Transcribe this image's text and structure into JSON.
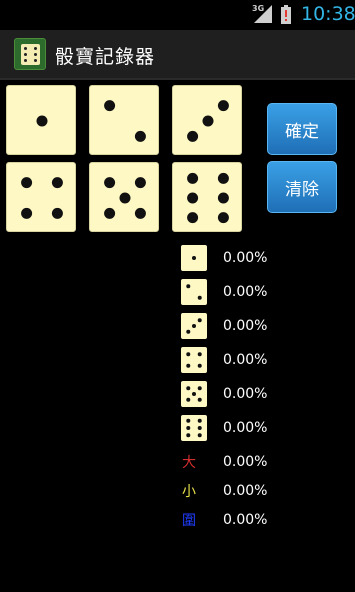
{
  "status_bar": {
    "network": "3G",
    "time": "10:38",
    "colors": {
      "time": "#33b5e5",
      "battery_alert": "#e53935"
    }
  },
  "app": {
    "title": "骰寶記錄器",
    "icon": "dice-app-icon"
  },
  "dice_buttons": [
    {
      "face": 1
    },
    {
      "face": 2
    },
    {
      "face": 3
    },
    {
      "face": 4
    },
    {
      "face": 5
    },
    {
      "face": 6
    }
  ],
  "buttons": {
    "confirm_label": "確定",
    "clear_label": "清除"
  },
  "stats": {
    "faces": [
      {
        "face": 1,
        "value": "0.00%"
      },
      {
        "face": 2,
        "value": "0.00%"
      },
      {
        "face": 3,
        "value": "0.00%"
      },
      {
        "face": 4,
        "value": "0.00%"
      },
      {
        "face": 5,
        "value": "0.00%"
      },
      {
        "face": 6,
        "value": "0.00%"
      }
    ],
    "big": {
      "label": "大",
      "value": "0.00%",
      "color": "#d32f2f"
    },
    "small": {
      "label": "小",
      "value": "0.00%",
      "color": "#e8e24a"
    },
    "triple": {
      "label": "圍",
      "value": "0.00%",
      "color": "#1e3cff"
    }
  },
  "colors": {
    "die_face": "#fdf8c4",
    "pip": "#111111",
    "button": "#1f6fb6"
  }
}
